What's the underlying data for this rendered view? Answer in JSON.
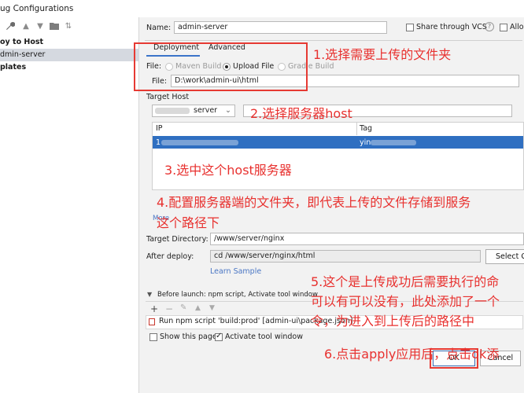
{
  "window": {
    "title": "ug Configurations"
  },
  "sidebar": {
    "items": [
      {
        "label": "oy to Host",
        "bold": true
      },
      {
        "label": "dmin-server",
        "selected": true
      },
      {
        "label": "plates",
        "bold": true
      }
    ]
  },
  "name": {
    "label": "Name:",
    "value": "admin-server"
  },
  "share": {
    "label": "Share through VCS",
    "help": "?",
    "allow_label": "Allow"
  },
  "tabs": [
    {
      "label": "Deployment"
    },
    {
      "label": "Advanced"
    }
  ],
  "file_row": {
    "label": "File:",
    "options": [
      {
        "label": "Maven Build"
      },
      {
        "label": "Upload File"
      },
      {
        "label": "Gradle Build"
      }
    ],
    "path_label": "File:",
    "path_value": "D:\\work\\admin-ui\\html"
  },
  "target_host": {
    "label": "Target Host",
    "select_value": "server",
    "columns": [
      "IP",
      "Tag"
    ],
    "row": {
      "ip": "1",
      "tag": "yin"
    }
  },
  "more_link": "More",
  "target_directory": {
    "label": "Target Directory:",
    "value": "/www/server/nginx"
  },
  "after_deploy": {
    "label": "After deploy:",
    "value": "cd /www/server/nginx/html",
    "button": "Select C"
  },
  "learn_sample": "Learn Sample",
  "before_launch": {
    "title": "Before launch: npm script, Activate tool window",
    "task": "Run npm script 'build:prod' [admin-ui\\package.json]",
    "show_page": "Show this page",
    "activate": "Activate tool window"
  },
  "buttons": {
    "ok": "OK",
    "cancel": "Cancel"
  },
  "annotations": {
    "a1": "1.选择需要上传的文件夹",
    "a2": "2.选择服务器host",
    "a3": "3.选中这个host服务器",
    "a4_line1": "4.配置服务器端的文件夹，即代表上传的文件存储到服务",
    "a4_line2": "这个路径下",
    "a5_line1": "5.这个是上传成功后需要执行的命",
    "a5_line2": "可以有可以没有，此处添加了一个",
    "a5_line3": "令，为进入到上传后的路径中",
    "a6": "6.点击apply应用后，点击ok添"
  },
  "colors": {
    "annotation": "#e8312f",
    "selection": "#2f6fc1",
    "link": "#4a76c4"
  }
}
